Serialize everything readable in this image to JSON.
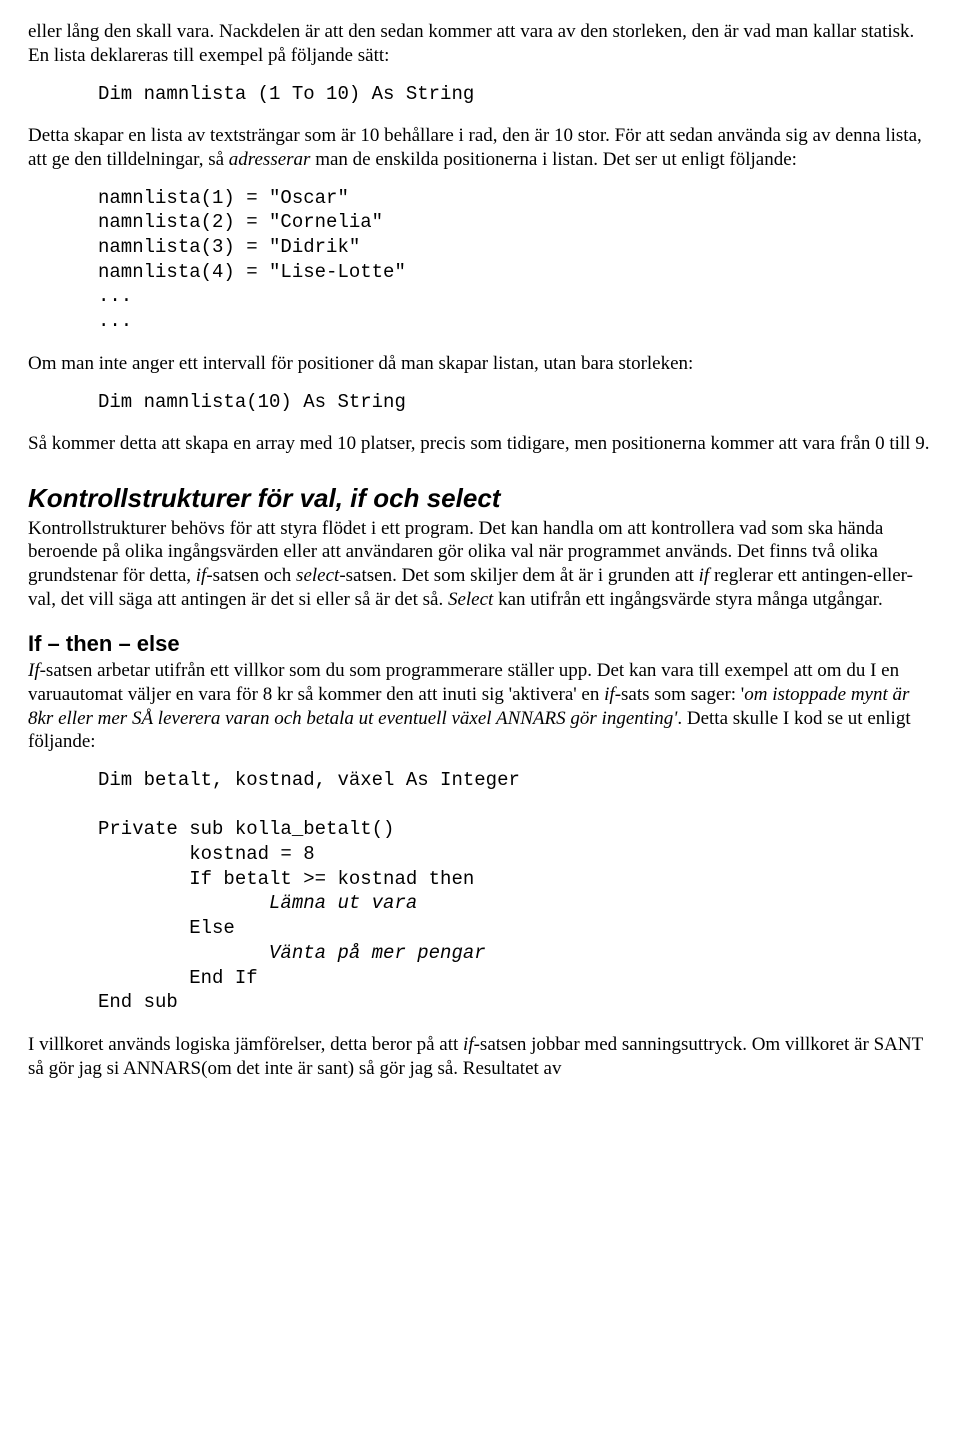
{
  "p1": "eller lång den skall vara. Nackdelen är att den sedan kommer att vara av den storleken, den är vad man kallar statisk. En lista deklareras till exempel på följande sätt:",
  "code1": "Dim namnlista (1 To 10) As String",
  "p2_a": "Detta skapar en lista av textsträngar som är 10 behållare i rad, den är 10 stor. För att sedan använda sig av denna lista, att ge den tilldelningar, så ",
  "p2_italic": "adresserar",
  "p2_b": " man de enskilda positionerna i listan. Det ser ut enligt följande:",
  "code2": "namnlista(1) = \"Oscar\"\nnamnlista(2) = \"Cornelia\"\nnamnlista(3) = \"Didrik\"\nnamnlista(4) = \"Lise-Lotte\"\n...\n...",
  "p3": "Om man inte anger ett intervall för positioner då man skapar listan, utan bara storleken:",
  "code3": "Dim namnlista(10) As String",
  "p4": "Så kommer detta att skapa en array med 10 platser, precis som tidigare, men positionerna kommer att vara från 0 till 9.",
  "h2": "Kontrollstrukturer för val, if och select",
  "p5_a": "Kontrollstrukturer behövs för att styra flödet i ett program. Det kan handla om att kontrollera vad som ska hända beroende på olika ingångsvärden eller att användaren gör olika val när programmet används. Det finns två olika grundstenar för detta, ",
  "p5_i1": "if",
  "p5_b": "-satsen och ",
  "p5_i2": "select",
  "p5_c": "-satsen. Det som skiljer dem åt är i grunden att ",
  "p5_i3": "if",
  "p5_d": " reglerar ett antingen-eller-val, det vill säga att antingen är det si eller så är det så. ",
  "p5_i4": "Select",
  "p5_e": " kan utifrån ett ingångsvärde styra många utgångar.",
  "h3": "If – then – else",
  "p6_i1": "If",
  "p6_a": "-satsen arbetar utifrån ett villkor som du som programmerare ställer upp. Det kan vara till exempel att om du I en varuautomat väljer en vara för 8 kr så kommer den att inuti sig 'aktivera' en ",
  "p6_i2": "if",
  "p6_b": "-sats som sager: '",
  "p6_i3": "om istoppade mynt är 8kr eller mer SÅ leverera varan och betala ut eventuell växel ANNARS gör ingenting'",
  "p6_c": ". Detta skulle I kod se ut enligt följande:",
  "code4_l1": "Dim betalt, kostnad, växel As Integer",
  "code4_l2": "Private sub kolla_betalt()",
  "code4_l3": "        kostnad = 8",
  "code4_l4": "        If betalt >= kostnad then",
  "code4_l5i": "               Lämna ut vara",
  "code4_l6": "        Else",
  "code4_l7i": "               Vänta på mer pengar",
  "code4_l8": "        End If",
  "code4_l9": "End sub",
  "p7_a": "I villkoret används logiska jämförelser, detta beror på att ",
  "p7_i1": "if",
  "p7_b": "-satsen jobbar med sanningsuttryck. Om villkoret är SANT så gör jag si ANNARS(om det inte är sant) så gör jag så. Resultatet av"
}
